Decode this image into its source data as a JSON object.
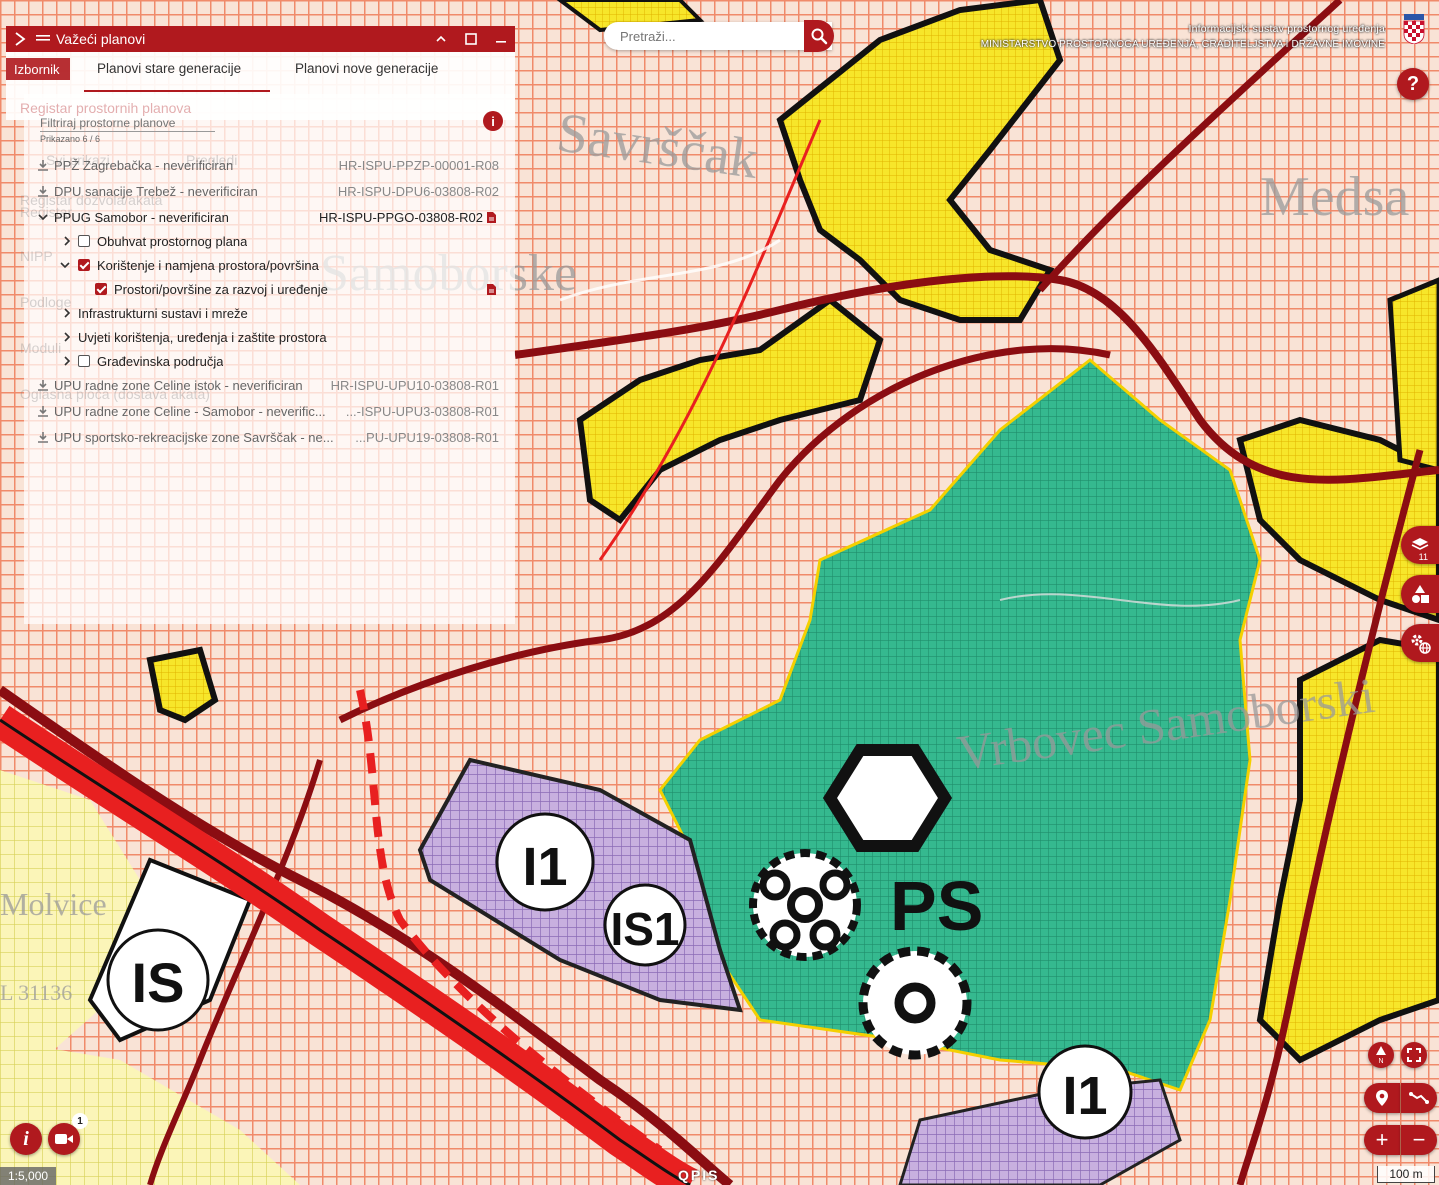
{
  "search": {
    "placeholder": "Pretraži..."
  },
  "brand": {
    "line1": "Informacijski sustav prostornog uređenja",
    "line2": "MINISTARSTVO PROSTORNOGA UREĐENJA, GRADITELJSTVA I DRŽAVNE IMOVINE"
  },
  "map_labels": {
    "place1": "Savrščak",
    "place2": "Medsa",
    "place3": "Samoborske",
    "place4": "Vrbovec Samoborski",
    "place5": "Molvice",
    "road": "L 31136",
    "zone_i1a": "I1",
    "zone_is1": "IS1",
    "zone_is": "IS",
    "zone_ps": "PS",
    "zone_i1b": "I1"
  },
  "panel": {
    "title": "Važeći planovi",
    "tabs": [
      {
        "label": "Izbornik"
      },
      {
        "label": "Planovi stare generacije",
        "active": true
      },
      {
        "label": "Planovi nove generacije"
      }
    ],
    "ghost_items": [
      "Registar prostornih planova",
      "Registar dozvola/akata",
      "Registar",
      "NIPP",
      "Podloge",
      "Moduli",
      "Oglasna ploča (dostava akata)",
      "Svi prikazi",
      "Pregledi"
    ],
    "filter": {
      "placeholder": "Filtriraj prostorne planove",
      "count": "Prikazano 6 / 6"
    },
    "plans": [
      {
        "name": "PPŽ Zagrebačka - neverificiran",
        "code": "HR-ISPU-PPZP-00001-R08"
      },
      {
        "name": "DPU sanacije Trebež - neverificiran",
        "code": "HR-ISPU-DPU6-03808-R02"
      },
      {
        "name": "PPUG Samobor - neverificiran",
        "code": "HR-ISPU-PPGO-03808-R02"
      },
      {
        "name": "UPU radne zone Celine istok - neverificiran",
        "code": "HR-ISPU-UPU10-03808-R01"
      },
      {
        "name": "UPU radne zone Celine - Samobor - neverific...",
        "code": "...-ISPU-UPU3-03808-R01"
      },
      {
        "name": "UPU sportsko-rekreacijske zone Savrščak - ne...",
        "code": "...PU-UPU19-03808-R01"
      }
    ],
    "layers": [
      {
        "label": "Obuhvat prostornog plana",
        "checked": false
      },
      {
        "label": "Korištenje i namjena prostora/površina",
        "checked": true
      },
      {
        "label": "Prostori/površine za razvoj i uređenje",
        "checked": true
      },
      {
        "label": "Infrastrukturni sustavi i mreže"
      },
      {
        "label": "Uvjeti korištenja, uređenja i zaštite prostora"
      },
      {
        "label": "Građevinska područja",
        "checked": false
      }
    ]
  },
  "tools": {
    "layers_count": "11"
  },
  "bottom": {
    "scale": "1:5,000",
    "scalebar": "100 m",
    "brand": "QPIS",
    "camera_badge": "1"
  },
  "icons": [
    "menu-icon",
    "chevron-up-icon",
    "maximize-icon",
    "minimize-icon",
    "search-icon",
    "help-icon",
    "layers-icon",
    "shapes-icon",
    "settings-globe-icon",
    "north-icon",
    "fullscreen-icon",
    "location-icon",
    "measure-icon",
    "zoom-in-icon",
    "zoom-out-icon",
    "info-icon",
    "camera-icon",
    "download-icon",
    "document-icon"
  ],
  "colors": {
    "accent": "#b0191e",
    "green_zone": "#2bb58e",
    "purple_zone": "#b595d0",
    "yellow_zone": "#f6e01a"
  }
}
